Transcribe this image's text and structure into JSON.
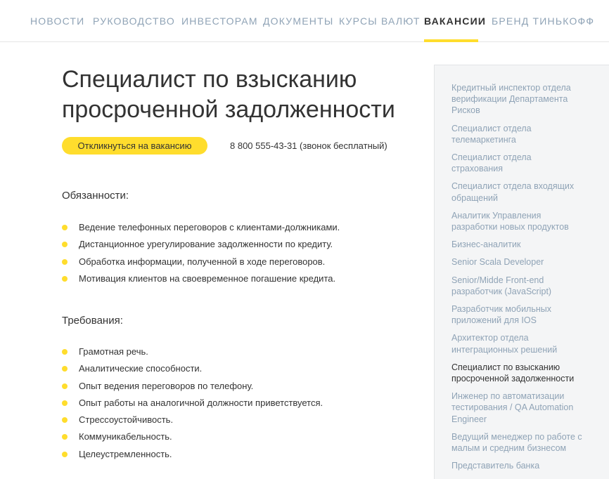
{
  "nav": {
    "items": [
      {
        "label": "НОВОСТИ"
      },
      {
        "label": "РУКОВОДСТВО"
      },
      {
        "label": "ИНВЕСТОРАМ"
      },
      {
        "label": "ДОКУМЕНТЫ"
      },
      {
        "label": "КУРСЫ ВАЛЮТ"
      },
      {
        "label": "ВАКАНСИИ"
      },
      {
        "label": "БРЕНД ТИНЬКОФФ"
      }
    ],
    "active_index": 5
  },
  "vacancy": {
    "title": "Специалист по взысканию просроченной задолженности",
    "apply_label": "Откликнуться на вакансию",
    "phone": "8 800 555-43-31 (звонок бесплатный)"
  },
  "duties": {
    "title": "Обязанности:",
    "items": [
      "Ведение телефонных переговоров с клиентами-должниками.",
      "Дистанционное урегулирование задолженности по кредиту.",
      "Обработка информации, полученной в ходе переговоров.",
      "Мотивация клиентов на своевременное погашение кредита."
    ]
  },
  "requirements": {
    "title": "Требования:",
    "items": [
      "Грамотная речь.",
      "Аналитические способности.",
      "Опыт ведения переговоров по телефону.",
      "Опыт работы на аналогичной должности приветствуется.",
      "Стрессоустойчивость.",
      "Коммуникабельность.",
      "Целеустремленность."
    ]
  },
  "sidebar": {
    "items": [
      {
        "lines": [
          "Кредитный инспектор отдела",
          "верификации Департамента",
          "Рисков"
        ]
      },
      {
        "lines": [
          "Специалист отдела",
          "телемаркетинга"
        ]
      },
      {
        "lines": [
          "Специалист отдела",
          "страхования"
        ]
      },
      {
        "lines": [
          "Специалист отдела входящих",
          "обращений"
        ]
      },
      {
        "lines": [
          "Аналитик Управления",
          "разработки новых продуктов"
        ]
      },
      {
        "lines": [
          "Бизнес-аналитик"
        ]
      },
      {
        "lines": [
          "Senior Scala Developer"
        ]
      },
      {
        "lines": [
          "Senior/Midde Front-end",
          "разработчик (JavaScript)"
        ]
      },
      {
        "lines": [
          "Разработчик мобильных",
          "приложений для IOS"
        ]
      },
      {
        "lines": [
          "Архитектор отдела",
          "интеграционных решений"
        ]
      },
      {
        "lines": [
          "Специалист по взысканию",
          "просроченной задолженности"
        ]
      },
      {
        "lines": [
          "Инженер по автоматизации",
          "тестирования / QA Automation",
          "Engineer"
        ]
      },
      {
        "lines": [
          "Ведущий менеджер по работе с",
          "малым и средним бизнесом"
        ]
      },
      {
        "lines": [
          "Представитель банка"
        ]
      }
    ],
    "current_index": 10
  },
  "colors": {
    "accent": "#ffdd2d",
    "link": "#8fa3b6",
    "text": "#333333",
    "sidebar_bg": "#f4f5f6"
  }
}
